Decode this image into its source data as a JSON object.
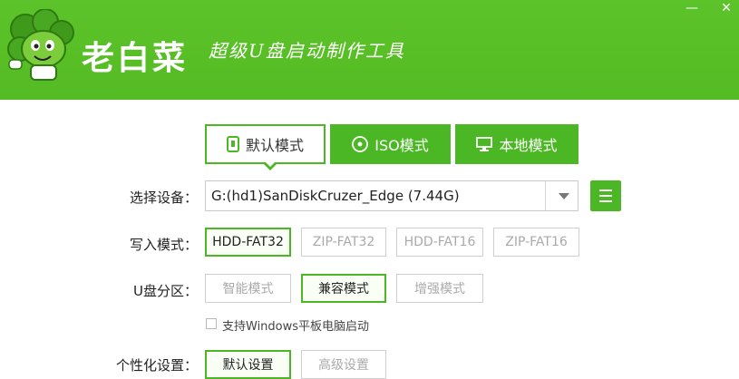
{
  "app": {
    "title": "老白菜",
    "slogan": "超级U盘启动制作工具",
    "minimize": "—",
    "close": "✕",
    "accent": "#4cb724"
  },
  "tabs": [
    {
      "label": "默认模式",
      "icon": "usb-drive-icon",
      "active": true
    },
    {
      "label": "ISO模式",
      "icon": "disc-icon",
      "active": false
    },
    {
      "label": "本地模式",
      "icon": "monitor-icon",
      "active": false
    }
  ],
  "device": {
    "label": "选择设备：",
    "value": "G:(hd1)SanDiskCruzer_Edge (7.44G)"
  },
  "write_mode": {
    "label": "写入模式：",
    "options": [
      "HDD-FAT32",
      "ZIP-FAT32",
      "HDD-FAT16",
      "ZIP-FAT16"
    ],
    "selected": "HDD-FAT32"
  },
  "partition": {
    "label": "U盘分区：",
    "options": [
      "智能模式",
      "兼容模式",
      "增强模式"
    ],
    "selected": "兼容模式"
  },
  "tablet_support": {
    "label": "支持Windows平板电脑启动",
    "checked": false
  },
  "personalize": {
    "label": "个性化设置：",
    "options": [
      "默认设置",
      "高级设置"
    ],
    "selected": "默认设置"
  }
}
